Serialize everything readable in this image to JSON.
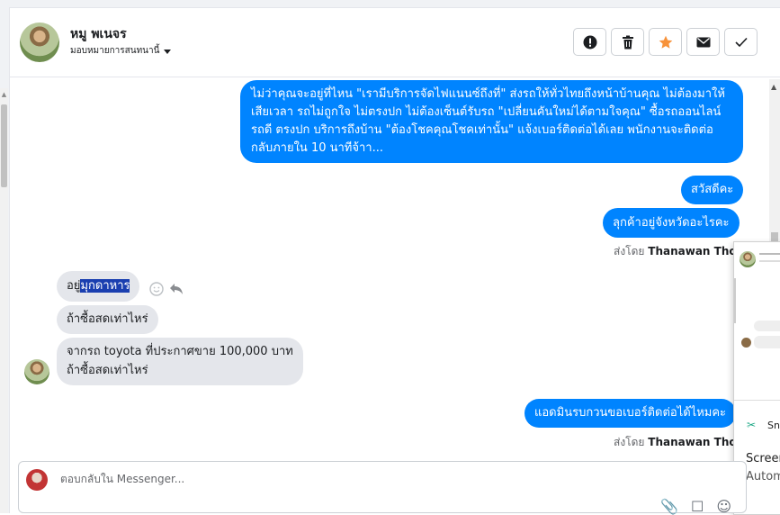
{
  "header": {
    "contact_name": "หมู พเนจร",
    "assign_label": "มอบหมายการสนทนานี้",
    "actions": [
      "mark-spam",
      "delete",
      "star",
      "mark-unread",
      "done"
    ]
  },
  "messages": {
    "out_long": "ไม่ว่าคุณจะอยู่ที่ไหน \"เรามีบริการจัดไฟแนนซ์ถึงที่\"  ส่งรถให้ทั่วไทยถึงหน้าบ้านคุณ ไม่ต้องมาให้เสียเวลา รถไม่ถูกใจ ไม่ตรงปก ไม่ต้องเซ็นต์รับรถ \"เปลี่ยนคันใหม่ได้ตามใจคุณ\" ซื้อรถออนไลน์ รถดี ตรงปก บริการถึงบ้าน \"ต้องโชคคุณโชคเท่านั้น\" แจ้งเบอร์ติดต่อได้เลย พนักงานจะติดต่อกลับภายใน 10 นาทีจ้าา...",
    "out_hello": "สวัสดีคะ",
    "out_province": "ลุกค้าอยู่จังหวัดอะไรคะ",
    "sent_by_prefix": "ส่งโดย",
    "sent_by_name": "Thanawan Thon",
    "in_1_prefix": "อยู",
    "in_1_selected": "่มุกดาหาร",
    "in_2": "ถ้าซื้อสดเท่าไหร่",
    "in_3_line1": "จากรถ toyota ที่ประกาศขาย 100,000 บาท",
    "in_3_line2": "ถ้าซื้อสดเท่าไหร่",
    "out_ask_phone": "แอดมินรบกวนขอเบอร์ติดต่อได้ไหมคะ"
  },
  "popup": {
    "snip_label": "Sn",
    "title_fragment": "Screer",
    "subtitle_fragment": "Autom"
  },
  "composer": {
    "placeholder": "ตอบกลับใน Messenger..."
  }
}
